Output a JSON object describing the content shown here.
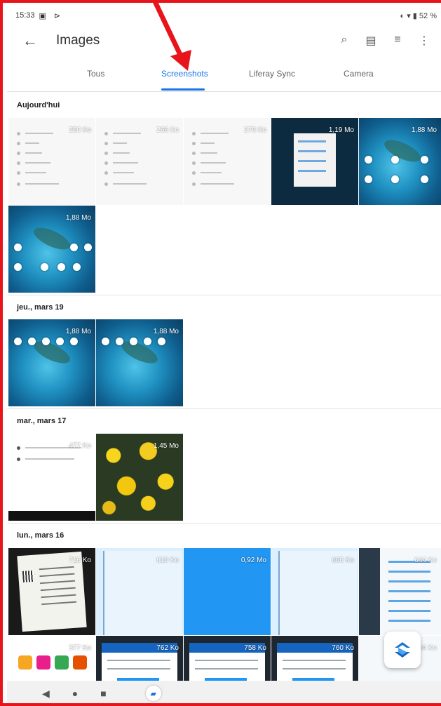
{
  "status": {
    "time": "15:33",
    "battery": "52 %"
  },
  "app": {
    "title": "Images"
  },
  "tabs": [
    {
      "label": "Tous"
    },
    {
      "label": "Screenshots"
    },
    {
      "label": "Liferay Sync"
    },
    {
      "label": "Camera"
    }
  ],
  "sections": [
    {
      "title": "Aujourd'hui"
    },
    {
      "title": "jeu., mars 19"
    },
    {
      "title": "mar., mars 17"
    },
    {
      "title": "lun., mars 16"
    }
  ],
  "tiles": [
    {
      "size": "250 Ko"
    },
    {
      "size": "266 Ko"
    },
    {
      "size": "276 Ko"
    },
    {
      "size": "1,19 Mo"
    },
    {
      "size": "1,88 Mo"
    },
    {
      "size": "1,88 Mo"
    },
    {
      "size": "1,88 Mo"
    },
    {
      "size": "1,88 Mo"
    },
    {
      "size": "477 Ko"
    },
    {
      "size": "1,45 Mo"
    },
    {
      "size": "716 Ko"
    },
    {
      "size": "610 Ko"
    },
    {
      "size": "0,92 Mo"
    },
    {
      "size": "606 Ko"
    },
    {
      "size": "644 Ko"
    },
    {
      "size": "377 Ko"
    },
    {
      "size": "762 Ko"
    },
    {
      "size": "758 Ko"
    },
    {
      "size": "760 Ko"
    },
    {
      "size": "594 Ko"
    }
  ],
  "colors": {
    "accent": "#1a73e8",
    "annotation": "#e8141b"
  }
}
